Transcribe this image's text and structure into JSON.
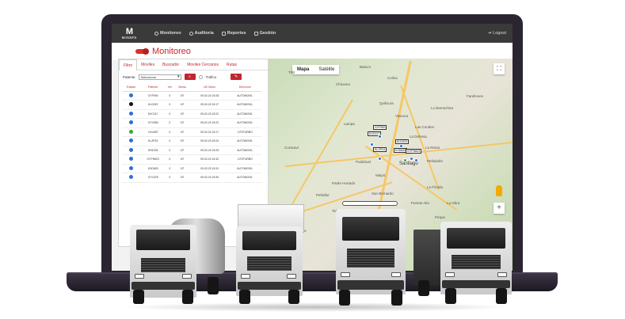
{
  "nav": {
    "logo_mark": "M",
    "logo_text": "MANSFS",
    "items": [
      {
        "label": "Monitoreo",
        "icon": "eye-icon"
      },
      {
        "label": "Auditoria",
        "icon": "gear-icon"
      },
      {
        "label": "Reportes",
        "icon": "document-icon"
      },
      {
        "label": "Gestión",
        "icon": "clipboard-icon"
      }
    ],
    "logout": "Logout"
  },
  "page": {
    "title": "Monitoreo"
  },
  "panel": {
    "tabs": [
      "Filtro",
      "Moviles",
      "Buscador",
      "Moviles Cercanos",
      "Rutas"
    ],
    "filter": {
      "patente_label": "Patente",
      "select_value": "Seleccione",
      "trafico_label": "Trafico"
    },
    "columns": [
      "Estado",
      "Patente",
      "Vel",
      "Senso",
      "Ult Odom",
      "Dirección"
    ],
    "rows": [
      {
        "color": "#2d6fd6",
        "patente": "GYF900",
        "vel": "0",
        "senso": "0/7",
        "fecha": "09-02-20 15:28",
        "dir": "AUTOMOVIL"
      },
      {
        "color": "#111111",
        "patente": "KLD023",
        "vel": "0",
        "senso": "0/7",
        "fecha": "09-02-20 15:17",
        "dir": "AUTOMOVIL"
      },
      {
        "color": "#2d6fd6",
        "patente": "KXC017",
        "vel": "0",
        "senso": "0/7",
        "fecha": "09-02-20 15:22",
        "dir": "AUTOMOVIL"
      },
      {
        "color": "#2d6fd6",
        "patente": "GYV983",
        "vel": "0",
        "senso": "0/7",
        "fecha": "09-02-20 15:22",
        "dir": "AUTOMOVIL"
      },
      {
        "color": "#3aa63a",
        "patente": "GLV492",
        "vel": "0",
        "senso": "0/7",
        "fecha": "09-02-20 15:17",
        "dir": "LITSTURBO"
      },
      {
        "color": "#2d6fd6",
        "patente": "KLZP24",
        "vel": "0",
        "senso": "0/7",
        "fecha": "09-02-20 15:24",
        "dir": "AUTOMOVIL"
      },
      {
        "color": "#2d6fd6",
        "patente": "KRZ233",
        "vel": "0",
        "senso": "0/7",
        "fecha": "09-02-20 15:25",
        "dir": "AUTOMOVIL"
      },
      {
        "color": "#2d6fd6",
        "patente": "GYPH823",
        "vel": "0",
        "senso": "0/7",
        "fecha": "09-02-20 15:32",
        "dir": "LITSTURBO"
      },
      {
        "color": "#2d6fd6",
        "patente": "KXD825",
        "vel": "0",
        "senso": "0/7",
        "fecha": "09-02-20 15:31",
        "dir": "AUTOMOVIL"
      },
      {
        "color": "#2d6fd6",
        "patente": "GYV329",
        "vel": "0",
        "senso": "0/7",
        "fecha": "09-02-20 15:30",
        "dir": "AUTOMOVIL"
      }
    ]
  },
  "map": {
    "type_buttons": [
      "Mapa",
      "Satélite"
    ],
    "fullscreen": "⛶",
    "zoom_in": "+",
    "places": [
      "Colina",
      "Chicureo",
      "Lampa",
      "La Dehesa",
      "Vitacura",
      "Las Condes",
      "La Reina",
      "Peñalolén",
      "Santiago",
      "Pudahuel",
      "Maipú",
      "La Florida",
      "Puente Alto",
      "San Bernardo",
      "Buin",
      "Padre Hurtado",
      "Talagante",
      "Melipilla",
      "Pirque",
      "Quilicura",
      "Batuco",
      "Tiltil",
      "Curacaví",
      "El Monte",
      "Isla de Maipo",
      "Calera de Tango",
      "La Obra",
      "San José de Maipo",
      "Lo Barnechea",
      "Farellones",
      "Peñaflor"
    ],
    "plates": [
      "GYF900",
      "KXC017",
      "KLD023",
      "KLZP24",
      "KXD825",
      "GYPH823"
    ]
  }
}
